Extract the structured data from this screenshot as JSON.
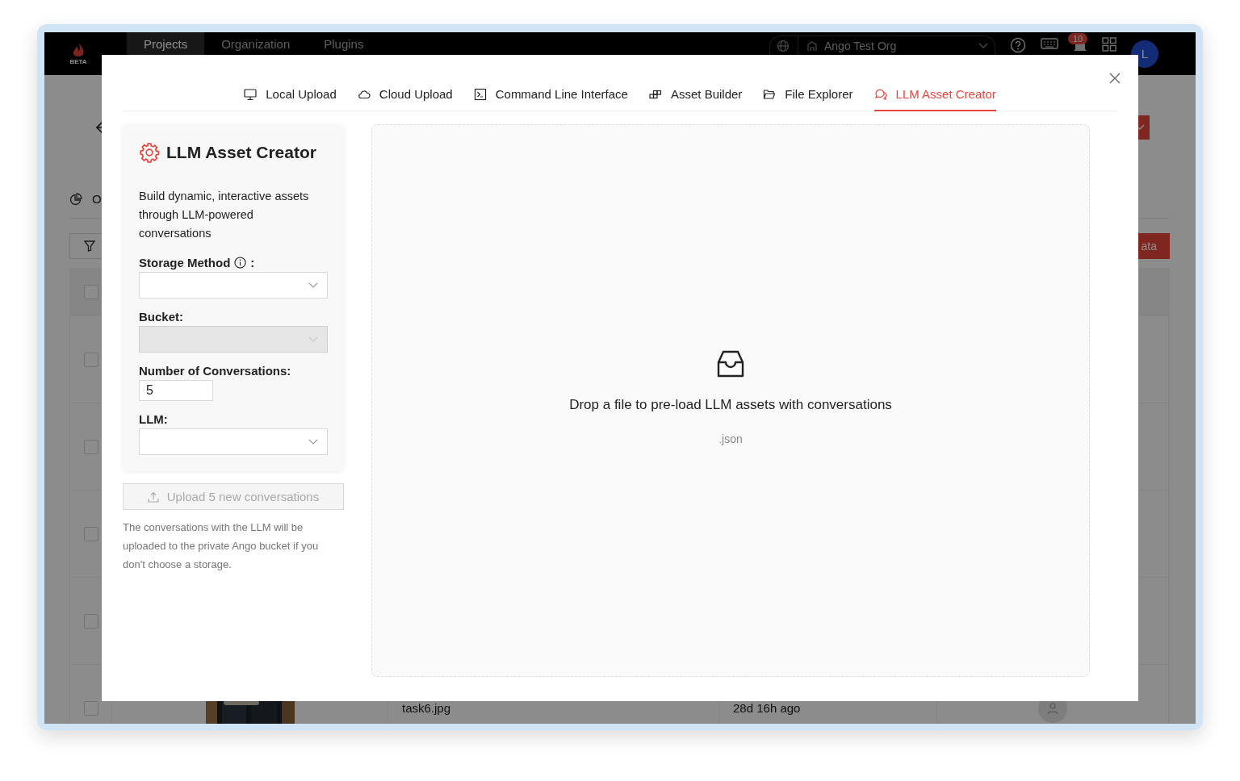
{
  "app_bar": {
    "logo_caption": "BETA",
    "nav": [
      {
        "label": "Projects",
        "selected": true
      },
      {
        "label": "Organization",
        "selected": false
      },
      {
        "label": "Plugins",
        "selected": false
      }
    ],
    "org_selector": {
      "value": "Ango Test Org"
    },
    "notifications_badge": "10",
    "avatar": "L"
  },
  "background": {
    "overview_tab": "O",
    "action_button": "ata",
    "rows": [
      {
        "checked": false,
        "kind": "header"
      },
      {
        "checked": false,
        "kind": "row"
      },
      {
        "checked": false,
        "kind": "row"
      },
      {
        "checked": false,
        "kind": "row"
      },
      {
        "checked": false,
        "kind": "row"
      },
      {
        "checked": false,
        "kind": "asset",
        "file": "task6.jpg",
        "time": "28d 16h ago"
      }
    ]
  },
  "modal": {
    "tabs": [
      {
        "label": "Local Upload",
        "selected": false
      },
      {
        "label": "Cloud Upload",
        "selected": false
      },
      {
        "label": "Command Line Interface",
        "selected": false
      },
      {
        "label": "Asset Builder",
        "selected": false
      },
      {
        "label": "File Explorer",
        "selected": false
      },
      {
        "label": "LLM Asset Creator",
        "selected": true
      }
    ],
    "panel": {
      "title": "LLM Asset Creator",
      "description": "Build dynamic, interactive assets through LLM-powered conversations",
      "fields": [
        {
          "label": "Storage Method",
          "info": true,
          "label_suffix": ":",
          "kind": "select",
          "disabled": false
        },
        {
          "label": "Bucket:",
          "info": false,
          "kind": "select",
          "disabled": true
        },
        {
          "label": "Number of Conversations:",
          "info": false,
          "kind": "number",
          "value": "5"
        },
        {
          "label": "LLM:",
          "info": false,
          "kind": "select",
          "disabled": false
        }
      ]
    },
    "upload_button": {
      "label": "Upload 5 new conversations",
      "disabled": true
    },
    "note": "The conversations with the LLM will be uploaded to the private Ango bucket if you don't choose a storage.",
    "dropzone": {
      "text": "Drop a file to pre-load LLM assets with conversations",
      "accepted": ".json"
    }
  }
}
